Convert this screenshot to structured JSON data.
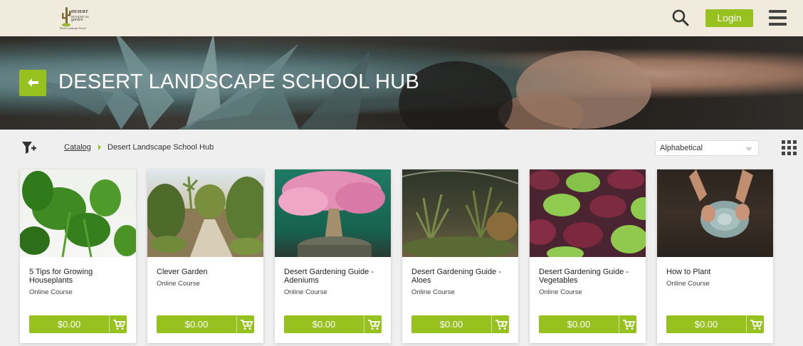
{
  "header": {
    "logo": {
      "line1": "DESERT",
      "line2": "BOTANICAL",
      "line3": "garden",
      "subtitle": "Desert Landscape School"
    },
    "login_label": "Login",
    "icons": {
      "search": "search-icon",
      "menu": "hamburger-menu-icon"
    }
  },
  "hero": {
    "title": "DESERT LANDSCAPE SCHOOL HUB",
    "back_icon": "back-arrow-icon"
  },
  "toolbar": {
    "breadcrumb": {
      "link": "Catalog",
      "current": "Desert Landscape School Hub"
    },
    "sort_value": "Alphabetical",
    "icons": {
      "filter": "filter-icon",
      "view": "grid-view-icon"
    }
  },
  "colors": {
    "accent": "#97c11f",
    "header_bg": "#f1ebde",
    "page_bg": "#efefef"
  },
  "courses": [
    {
      "title": "5 Tips for Growing Houseplants",
      "type": "Online Course",
      "price": "$0.00",
      "image": "monstera-plant-photo"
    },
    {
      "title": "Clever Garden",
      "type": "Online Course",
      "price": "$0.00",
      "image": "desert-garden-path-photo"
    },
    {
      "title": "Desert Gardening Guide - Adeniums",
      "type": "Online Course",
      "price": "$0.00",
      "image": "adenium-bonsai-photo"
    },
    {
      "title": "Desert Gardening Guide - Aloes",
      "type": "Online Course",
      "price": "$0.00",
      "image": "aloe-garden-photo"
    },
    {
      "title": "Desert Gardening Guide - Vegetables",
      "type": "Online Course",
      "price": "$0.00",
      "image": "lettuce-bed-photo"
    },
    {
      "title": "How to Plant",
      "type": "Online Course",
      "price": "$0.00",
      "image": "planting-succulent-photo"
    }
  ]
}
